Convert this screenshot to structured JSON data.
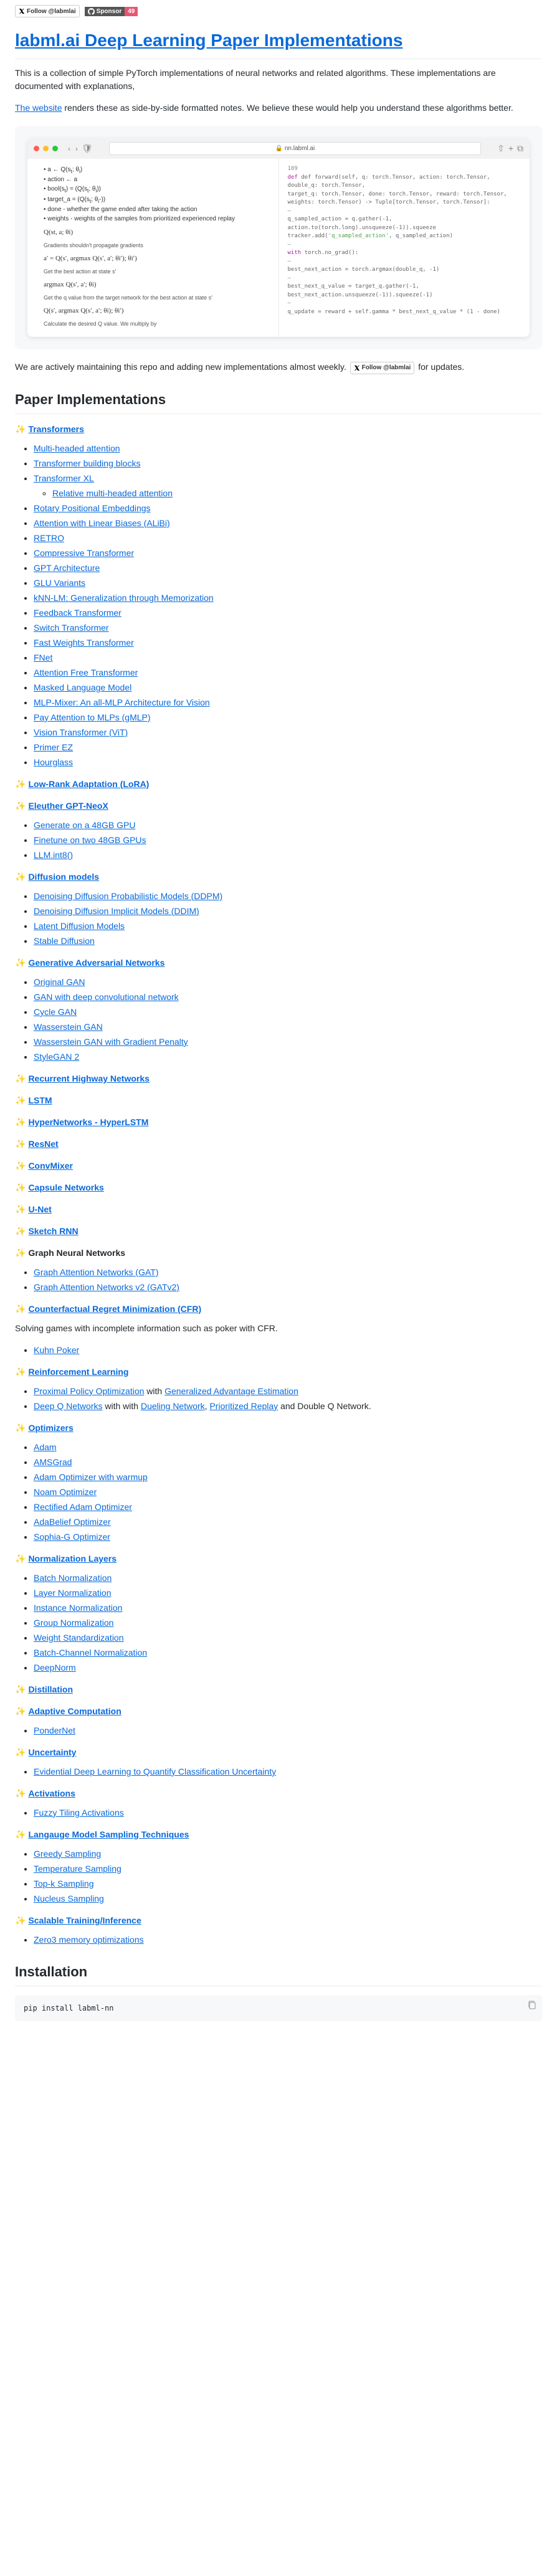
{
  "badges": {
    "follow": "Follow @labmlai",
    "sponsor_left": "Sponsor",
    "sponsor_right": "49"
  },
  "title": "labml.ai Deep Learning Paper Implementations",
  "intro_p1": "This is a collection of simple PyTorch implementations of neural networks and related algorithms. These implementations are documented with explanations,",
  "intro_p2_a": "The website",
  "intro_p2_b": " renders these as side-by-side formatted notes. We believe these would help you understand these algorithms better.",
  "browser_url": "nn.labml.ai",
  "maintain_a": "We are actively maintaining this repo and adding new implementations almost weekly. ",
  "maintain_b": " for updates.",
  "h2_impl": "Paper Implementations",
  "sections": [
    {
      "emoji": "✨",
      "title": "Transformers",
      "link": true,
      "items": [
        {
          "t": "Multi-headed attention"
        },
        {
          "t": "Transformer building blocks"
        },
        {
          "t": "Transformer XL",
          "sub": [
            {
              "t": "Relative multi-headed attention"
            }
          ]
        },
        {
          "t": "Rotary Positional Embeddings"
        },
        {
          "t": "Attention with Linear Biases (ALiBi)"
        },
        {
          "t": "RETRO"
        },
        {
          "t": "Compressive Transformer"
        },
        {
          "t": "GPT Architecture"
        },
        {
          "t": "GLU Variants"
        },
        {
          "t": "kNN-LM: Generalization through Memorization"
        },
        {
          "t": "Feedback Transformer"
        },
        {
          "t": "Switch Transformer"
        },
        {
          "t": "Fast Weights Transformer"
        },
        {
          "t": "FNet"
        },
        {
          "t": "Attention Free Transformer"
        },
        {
          "t": "Masked Language Model"
        },
        {
          "t": "MLP-Mixer: An all-MLP Architecture for Vision"
        },
        {
          "t": "Pay Attention to MLPs (gMLP)"
        },
        {
          "t": "Vision Transformer (ViT)"
        },
        {
          "t": "Primer EZ"
        },
        {
          "t": "Hourglass"
        }
      ]
    },
    {
      "emoji": "✨",
      "title": "Low-Rank Adaptation (LoRA)",
      "link": true,
      "items": []
    },
    {
      "emoji": "✨",
      "title": "Eleuther GPT-NeoX",
      "link": true,
      "items": [
        {
          "t": "Generate on a 48GB GPU"
        },
        {
          "t": "Finetune on two 48GB GPUs"
        },
        {
          "t": "LLM.int8()"
        }
      ]
    },
    {
      "emoji": "✨",
      "title": "Diffusion models",
      "link": true,
      "items": [
        {
          "t": "Denoising Diffusion Probabilistic Models (DDPM)"
        },
        {
          "t": "Denoising Diffusion Implicit Models (DDIM)"
        },
        {
          "t": "Latent Diffusion Models"
        },
        {
          "t": "Stable Diffusion"
        }
      ]
    },
    {
      "emoji": "✨",
      "title": "Generative Adversarial Networks",
      "link": true,
      "items": [
        {
          "t": "Original GAN"
        },
        {
          "t": "GAN with deep convolutional network"
        },
        {
          "t": "Cycle GAN"
        },
        {
          "t": "Wasserstein GAN"
        },
        {
          "t": "Wasserstein GAN with Gradient Penalty"
        },
        {
          "t": "StyleGAN 2"
        }
      ]
    },
    {
      "emoji": "✨",
      "title": "Recurrent Highway Networks",
      "link": true,
      "items": []
    },
    {
      "emoji": "✨",
      "title": "LSTM",
      "link": true,
      "items": []
    },
    {
      "emoji": "✨",
      "title": "HyperNetworks - HyperLSTM",
      "link": true,
      "items": []
    },
    {
      "emoji": "✨",
      "title": "ResNet",
      "link": true,
      "items": []
    },
    {
      "emoji": "✨",
      "title": "ConvMixer",
      "link": true,
      "items": []
    },
    {
      "emoji": "✨",
      "title": "Capsule Networks",
      "link": true,
      "items": []
    },
    {
      "emoji": "✨",
      "title": "U-Net",
      "link": true,
      "items": []
    },
    {
      "emoji": "✨",
      "title": "Sketch RNN",
      "link": true,
      "items": []
    },
    {
      "emoji": "✨",
      "title": "Graph Neural Networks",
      "link": false,
      "items": [
        {
          "t": "Graph Attention Networks (GAT)"
        },
        {
          "t": "Graph Attention Networks v2 (GATv2)"
        }
      ]
    },
    {
      "emoji": "✨",
      "title": "Counterfactual Regret Minimization (CFR)",
      "link": true,
      "desc": "Solving games with incomplete information such as poker with CFR.",
      "items": [
        {
          "t": "Kuhn Poker"
        }
      ]
    },
    {
      "emoji": "✨",
      "title": "Reinforcement Learning",
      "link": true,
      "items": [
        {
          "raw": true,
          "html_parts": [
            {
              "t": "Proximal Policy Optimization",
              "link": true
            },
            {
              "t": " with ",
              "link": false
            },
            {
              "t": "Generalized Advantage Estimation",
              "link": true
            }
          ]
        },
        {
          "raw": true,
          "html_parts": [
            {
              "t": "Deep Q Networks",
              "link": true
            },
            {
              "t": " with with ",
              "link": false
            },
            {
              "t": "Dueling Network",
              "link": true
            },
            {
              "t": ", ",
              "link": false
            },
            {
              "t": "Prioritized Replay",
              "link": true
            },
            {
              "t": " and Double Q Network.",
              "link": false
            }
          ]
        }
      ]
    },
    {
      "emoji": "✨",
      "title": "Optimizers",
      "link": true,
      "items": [
        {
          "t": "Adam"
        },
        {
          "t": "AMSGrad"
        },
        {
          "t": "Adam Optimizer with warmup"
        },
        {
          "t": "Noam Optimizer"
        },
        {
          "t": "Rectified Adam Optimizer"
        },
        {
          "t": "AdaBelief Optimizer"
        },
        {
          "t": "Sophia-G Optimizer"
        }
      ]
    },
    {
      "emoji": "✨",
      "title": "Normalization Layers",
      "link": true,
      "items": [
        {
          "t": "Batch Normalization"
        },
        {
          "t": "Layer Normalization"
        },
        {
          "t": "Instance Normalization"
        },
        {
          "t": "Group Normalization"
        },
        {
          "t": "Weight Standardization"
        },
        {
          "t": "Batch-Channel Normalization"
        },
        {
          "t": "DeepNorm"
        }
      ]
    },
    {
      "emoji": "✨",
      "title": "Distillation",
      "link": true,
      "items": []
    },
    {
      "emoji": "✨",
      "title": "Adaptive Computation",
      "link": true,
      "items": [
        {
          "t": "PonderNet"
        }
      ]
    },
    {
      "emoji": "✨",
      "title": "Uncertainty",
      "link": true,
      "items": [
        {
          "t": "Evidential Deep Learning to Quantify Classification Uncertainty"
        }
      ]
    },
    {
      "emoji": "✨",
      "title": "Activations",
      "link": true,
      "items": [
        {
          "t": "Fuzzy Tiling Activations"
        }
      ]
    },
    {
      "emoji": "✨",
      "title": "Langauge Model Sampling Techniques",
      "link": true,
      "items": [
        {
          "t": "Greedy Sampling"
        },
        {
          "t": "Temperature Sampling"
        },
        {
          "t": "Top-k Sampling"
        },
        {
          "t": "Nucleus Sampling"
        }
      ]
    },
    {
      "emoji": "✨",
      "title": "Scalable Training/Inference",
      "link": true,
      "items": [
        {
          "t": "Zero3 memory optimizations"
        }
      ]
    }
  ],
  "h2_install": "Installation",
  "install_cmd": "pip install labml-nn",
  "shot_left": {
    "l1a": "a ← Q(s",
    "l1b": "t",
    "l1c": "; θ",
    "l1d": "i",
    "l1e": ")",
    "l2": "action ← a",
    "l3a": "bool(s",
    "l3b": "t",
    "l3c": ") = (Q(s",
    "l3d": "t",
    "l3e": "; θ",
    "l3f": "i",
    "l3g": "))",
    "l4a": "target_a = (Q(s",
    "l4b": "t",
    "l4c": "; θ",
    "l4d": "i",
    "l4e": "-))",
    "l5": "done - whether the game ended after taking the action",
    "l6": "weights - weights of the samples from prioritized experienced replay",
    "f1": "Q(st, a; θi)",
    "d1": "Gradients shouldn't propagate gradients",
    "f2": "a′ = Q(s′, argmax Q(s′, a′; θi′); θi′)",
    "d2": "Get the best action at state s′",
    "f3": "argmax Q(s′, a′; θi)",
    "d3": "Get the q value from the target network for the best action at state s′",
    "f4": "Q(s′, argmax Q(s′, a′; θi); θi′)",
    "d4": "Calculate the desired Q value. We multiply by"
  },
  "shot_right": {
    "r1": "def forward(self, q: torch.Tensor, action: torch.Tensor, double_q: torch.Tensor,",
    "r2": "            target_q: torch.Tensor, done: torch.Tensor, reward: torch.Tensor,",
    "r3": "            weights: torch.Tensor) -> Tuple[torch.Tensor, torch.Tensor]:",
    "r4": "q_sampled_action = q.gather(-1, action.to(torch.long).unsqueeze(-1)).squeeze",
    "r5": "tracker.add('q_sampled_action', q_sampled_action)",
    "r6": "with torch.no_grad():",
    "r7": "    best_next_action = torch.argmax(double_q, -1)",
    "r8": "    best_next_q_value = target_q.gather(-1, best_next_action.unsqueeze(-1)).squeeze(-1)",
    "r9": "q_update = reward + self.gamma * best_next_q_value * (1 - done)"
  }
}
